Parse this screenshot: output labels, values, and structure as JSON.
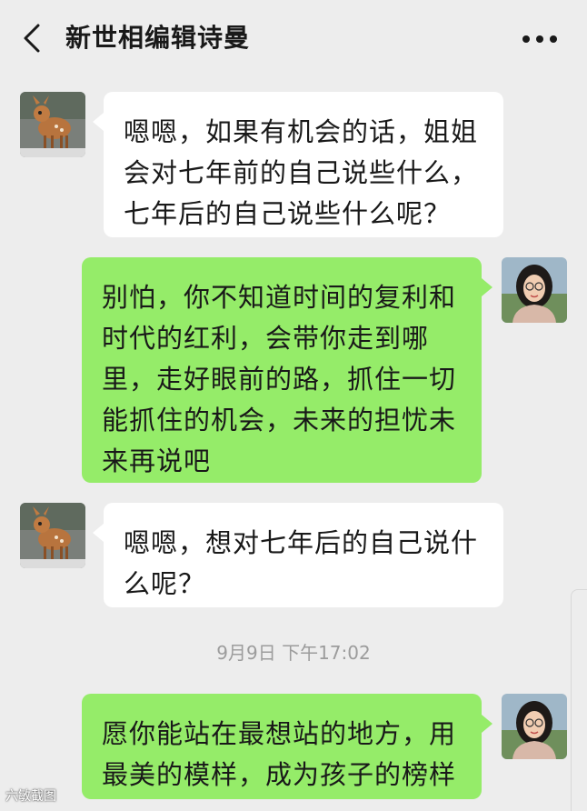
{
  "header": {
    "title": "新世相编辑诗曼"
  },
  "messages": [
    {
      "side": "left",
      "text": "嗯嗯，如果有机会的话，姐姐会对七年前的自己说些什么，七年后的自己说些什么呢？",
      "avatar": "deer-avatar"
    },
    {
      "side": "right",
      "text": "别怕，你不知道时间的复利和时代的红利，会带你走到哪里，走好眼前的路，抓住一切能抓住的机会，未来的担忧未来再说吧",
      "avatar": "woman-avatar"
    },
    {
      "side": "left",
      "text": "嗯嗯，想对七年后的自己说什么呢？",
      "avatar": "deer-avatar"
    },
    {
      "side": "right",
      "text": "愿你能站在最想站的地方，用最美的模样，成为孩子的榜样",
      "avatar": "woman-avatar"
    }
  ],
  "timestamp": "9月9日 下午17:02",
  "watermark": "六敏截图",
  "colors": {
    "background": "#ededed",
    "bubble_left": "#ffffff",
    "bubble_right": "#95ec69",
    "timestamp": "#9c9c9c"
  }
}
